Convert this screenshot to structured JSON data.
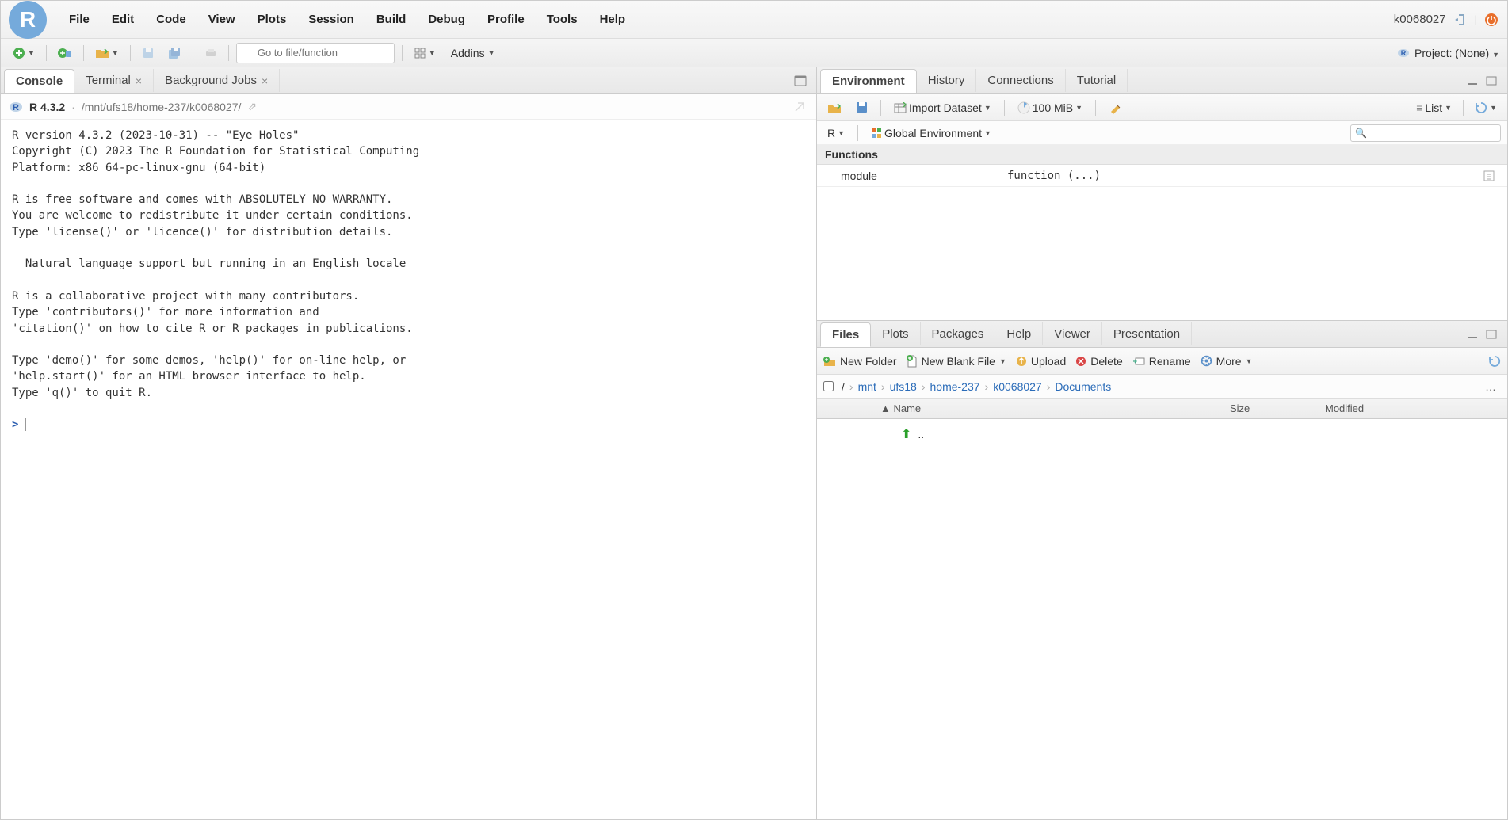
{
  "menubar": {
    "items": [
      "File",
      "Edit",
      "Code",
      "View",
      "Plots",
      "Session",
      "Build",
      "Debug",
      "Profile",
      "Tools",
      "Help"
    ],
    "username": "k0068027"
  },
  "toolbar": {
    "goto_placeholder": "Go to file/function",
    "addins_label": "Addins",
    "project_label": "Project: (None)"
  },
  "left_tabs": {
    "items": [
      {
        "label": "Console",
        "active": true,
        "closable": false
      },
      {
        "label": "Terminal",
        "active": false,
        "closable": true
      },
      {
        "label": "Background Jobs",
        "active": false,
        "closable": true
      }
    ]
  },
  "console_info": {
    "r_version": "R 4.3.2",
    "path": "/mnt/ufs18/home-237/k0068027/"
  },
  "console_text": "R version 4.3.2 (2023-10-31) -- \"Eye Holes\"\nCopyright (C) 2023 The R Foundation for Statistical Computing\nPlatform: x86_64-pc-linux-gnu (64-bit)\n\nR is free software and comes with ABSOLUTELY NO WARRANTY.\nYou are welcome to redistribute it under certain conditions.\nType 'license()' or 'licence()' for distribution details.\n\n  Natural language support but running in an English locale\n\nR is a collaborative project with many contributors.\nType 'contributors()' for more information and\n'citation()' on how to cite R or R packages in publications.\n\nType 'demo()' for some demos, 'help()' for on-line help, or\n'help.start()' for an HTML browser interface to help.\nType 'q()' to quit R.\n\n",
  "console_prompt": ">",
  "env_tabs": {
    "items": [
      {
        "label": "Environment",
        "active": true
      },
      {
        "label": "History",
        "active": false
      },
      {
        "label": "Connections",
        "active": false
      },
      {
        "label": "Tutorial",
        "active": false
      }
    ]
  },
  "env_toolbar": {
    "import_label": "Import Dataset",
    "memory": "100 MiB",
    "view_label": "List"
  },
  "env_sub": {
    "lang": "R",
    "scope": "Global Environment"
  },
  "env_section": "Functions",
  "env_rows": [
    {
      "name": "module",
      "value": "function (...)"
    }
  ],
  "files_tabs": {
    "items": [
      {
        "label": "Files",
        "active": true
      },
      {
        "label": "Plots",
        "active": false
      },
      {
        "label": "Packages",
        "active": false
      },
      {
        "label": "Help",
        "active": false
      },
      {
        "label": "Viewer",
        "active": false
      },
      {
        "label": "Presentation",
        "active": false
      }
    ]
  },
  "files_toolbar": {
    "new_folder": "New Folder",
    "new_blank": "New Blank File",
    "upload": "Upload",
    "delete": "Delete",
    "rename": "Rename",
    "more": "More"
  },
  "breadcrumb": {
    "root": "/",
    "parts": [
      "mnt",
      "ufs18",
      "home-237",
      "k0068027",
      "Documents"
    ]
  },
  "files_header": {
    "name": "Name",
    "size": "Size",
    "modified": "Modified"
  },
  "files_rows": [
    {
      "name": "..",
      "up": true
    }
  ]
}
